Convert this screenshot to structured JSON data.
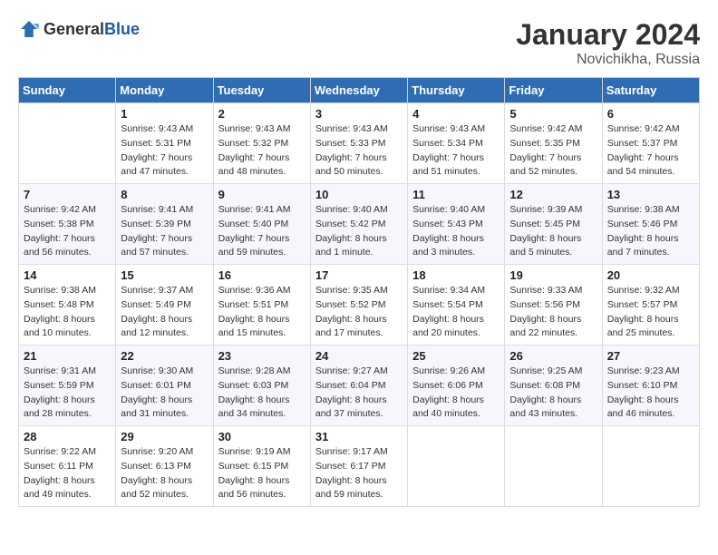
{
  "logo": {
    "general": "General",
    "blue": "Blue"
  },
  "title": "January 2024",
  "location": "Novichikha, Russia",
  "days_of_week": [
    "Sunday",
    "Monday",
    "Tuesday",
    "Wednesday",
    "Thursday",
    "Friday",
    "Saturday"
  ],
  "weeks": [
    [
      {
        "day": "",
        "info": ""
      },
      {
        "day": "1",
        "info": "Sunrise: 9:43 AM\nSunset: 5:31 PM\nDaylight: 7 hours\nand 47 minutes."
      },
      {
        "day": "2",
        "info": "Sunrise: 9:43 AM\nSunset: 5:32 PM\nDaylight: 7 hours\nand 48 minutes."
      },
      {
        "day": "3",
        "info": "Sunrise: 9:43 AM\nSunset: 5:33 PM\nDaylight: 7 hours\nand 50 minutes."
      },
      {
        "day": "4",
        "info": "Sunrise: 9:43 AM\nSunset: 5:34 PM\nDaylight: 7 hours\nand 51 minutes."
      },
      {
        "day": "5",
        "info": "Sunrise: 9:42 AM\nSunset: 5:35 PM\nDaylight: 7 hours\nand 52 minutes."
      },
      {
        "day": "6",
        "info": "Sunrise: 9:42 AM\nSunset: 5:37 PM\nDaylight: 7 hours\nand 54 minutes."
      }
    ],
    [
      {
        "day": "7",
        "info": "Sunrise: 9:42 AM\nSunset: 5:38 PM\nDaylight: 7 hours\nand 56 minutes."
      },
      {
        "day": "8",
        "info": "Sunrise: 9:41 AM\nSunset: 5:39 PM\nDaylight: 7 hours\nand 57 minutes."
      },
      {
        "day": "9",
        "info": "Sunrise: 9:41 AM\nSunset: 5:40 PM\nDaylight: 7 hours\nand 59 minutes."
      },
      {
        "day": "10",
        "info": "Sunrise: 9:40 AM\nSunset: 5:42 PM\nDaylight: 8 hours\nand 1 minute."
      },
      {
        "day": "11",
        "info": "Sunrise: 9:40 AM\nSunset: 5:43 PM\nDaylight: 8 hours\nand 3 minutes."
      },
      {
        "day": "12",
        "info": "Sunrise: 9:39 AM\nSunset: 5:45 PM\nDaylight: 8 hours\nand 5 minutes."
      },
      {
        "day": "13",
        "info": "Sunrise: 9:38 AM\nSunset: 5:46 PM\nDaylight: 8 hours\nand 7 minutes."
      }
    ],
    [
      {
        "day": "14",
        "info": "Sunrise: 9:38 AM\nSunset: 5:48 PM\nDaylight: 8 hours\nand 10 minutes."
      },
      {
        "day": "15",
        "info": "Sunrise: 9:37 AM\nSunset: 5:49 PM\nDaylight: 8 hours\nand 12 minutes."
      },
      {
        "day": "16",
        "info": "Sunrise: 9:36 AM\nSunset: 5:51 PM\nDaylight: 8 hours\nand 15 minutes."
      },
      {
        "day": "17",
        "info": "Sunrise: 9:35 AM\nSunset: 5:52 PM\nDaylight: 8 hours\nand 17 minutes."
      },
      {
        "day": "18",
        "info": "Sunrise: 9:34 AM\nSunset: 5:54 PM\nDaylight: 8 hours\nand 20 minutes."
      },
      {
        "day": "19",
        "info": "Sunrise: 9:33 AM\nSunset: 5:56 PM\nDaylight: 8 hours\nand 22 minutes."
      },
      {
        "day": "20",
        "info": "Sunrise: 9:32 AM\nSunset: 5:57 PM\nDaylight: 8 hours\nand 25 minutes."
      }
    ],
    [
      {
        "day": "21",
        "info": "Sunrise: 9:31 AM\nSunset: 5:59 PM\nDaylight: 8 hours\nand 28 minutes."
      },
      {
        "day": "22",
        "info": "Sunrise: 9:30 AM\nSunset: 6:01 PM\nDaylight: 8 hours\nand 31 minutes."
      },
      {
        "day": "23",
        "info": "Sunrise: 9:28 AM\nSunset: 6:03 PM\nDaylight: 8 hours\nand 34 minutes."
      },
      {
        "day": "24",
        "info": "Sunrise: 9:27 AM\nSunset: 6:04 PM\nDaylight: 8 hours\nand 37 minutes."
      },
      {
        "day": "25",
        "info": "Sunrise: 9:26 AM\nSunset: 6:06 PM\nDaylight: 8 hours\nand 40 minutes."
      },
      {
        "day": "26",
        "info": "Sunrise: 9:25 AM\nSunset: 6:08 PM\nDaylight: 8 hours\nand 43 minutes."
      },
      {
        "day": "27",
        "info": "Sunrise: 9:23 AM\nSunset: 6:10 PM\nDaylight: 8 hours\nand 46 minutes."
      }
    ],
    [
      {
        "day": "28",
        "info": "Sunrise: 9:22 AM\nSunset: 6:11 PM\nDaylight: 8 hours\nand 49 minutes."
      },
      {
        "day": "29",
        "info": "Sunrise: 9:20 AM\nSunset: 6:13 PM\nDaylight: 8 hours\nand 52 minutes."
      },
      {
        "day": "30",
        "info": "Sunrise: 9:19 AM\nSunset: 6:15 PM\nDaylight: 8 hours\nand 56 minutes."
      },
      {
        "day": "31",
        "info": "Sunrise: 9:17 AM\nSunset: 6:17 PM\nDaylight: 8 hours\nand 59 minutes."
      },
      {
        "day": "",
        "info": ""
      },
      {
        "day": "",
        "info": ""
      },
      {
        "day": "",
        "info": ""
      }
    ]
  ]
}
